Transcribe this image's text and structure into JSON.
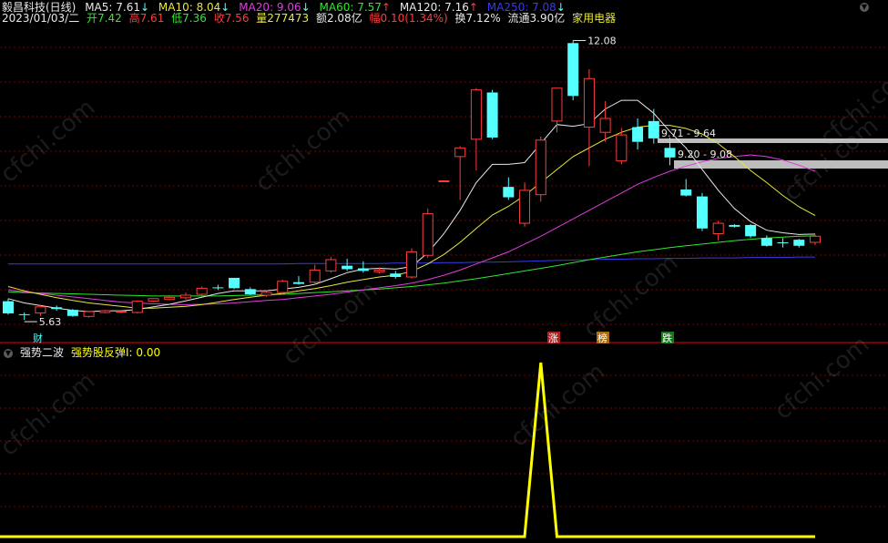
{
  "header": {
    "stock_name": "毅昌科技(日线)",
    "ma5": {
      "label": "MA5: 7.61",
      "arrow": "↓",
      "color": "#e8e8e8"
    },
    "ma10": {
      "label": "MA10: 8.04",
      "arrow": "↓",
      "color": "#e8e83a"
    },
    "ma20": {
      "label": "MA20: 9.06",
      "arrow": "↓",
      "color": "#e23ce2"
    },
    "ma60": {
      "label": "MA60: 7.57",
      "arrow": "↑",
      "color": "#2ee82e"
    },
    "ma120": {
      "label": "MA120: 7.16",
      "arrow": "↑",
      "color": "#e8e8e8"
    },
    "ma250": {
      "label": "MA250: 7.08",
      "arrow": "↓",
      "color": "#3a3ae8"
    }
  },
  "quote": {
    "date": "2023/01/03/二",
    "open": "开7.42",
    "high": "高7.61",
    "low": "低7.36",
    "close": "收7.56",
    "volume": "量277473",
    "amount": "额2.08亿",
    "change": "幅0.10(1.34%)",
    "turnover": "换7.12%",
    "float": "流通3.90亿",
    "industry": "家用电器"
  },
  "annotations": {
    "high_price": "12.08",
    "low_price": "5.63",
    "zone1": "9.71 - 9.64",
    "zone2": "9.20 - 9.08",
    "marker_cai": "财",
    "marker_zhang": "涨",
    "marker_bang": "榜",
    "marker_die": "跌"
  },
  "indicator": {
    "name": "强势二波",
    "line_label": "强势股反弹I: 0.00"
  },
  "watermark": "cfchi.com",
  "colors": {
    "up": "#ff3c3c",
    "down": "#54ffff",
    "grid": "#800000",
    "indicator": "#ffff00"
  },
  "chart_data": {
    "type": "candlestick",
    "ylim": [
      5.4,
      12.3
    ],
    "candles": [
      {
        "o": 6.06,
        "h": 6.12,
        "l": 5.75,
        "c": 5.78
      },
      {
        "o": 5.76,
        "h": 5.8,
        "l": 5.63,
        "c": 5.74
      },
      {
        "o": 5.79,
        "h": 5.98,
        "l": 5.72,
        "c": 5.93
      },
      {
        "o": 5.92,
        "h": 5.96,
        "l": 5.84,
        "c": 5.88
      },
      {
        "o": 5.86,
        "h": 5.88,
        "l": 5.7,
        "c": 5.72
      },
      {
        "o": 5.71,
        "h": 5.84,
        "l": 5.68,
        "c": 5.82
      },
      {
        "o": 5.8,
        "h": 5.86,
        "l": 5.78,
        "c": 5.84
      },
      {
        "o": 5.82,
        "h": 5.84,
        "l": 5.78,
        "c": 5.83
      },
      {
        "o": 5.8,
        "h": 6.08,
        "l": 5.78,
        "c": 6.06
      },
      {
        "o": 6.06,
        "h": 6.13,
        "l": 6.04,
        "c": 6.12
      },
      {
        "o": 6.1,
        "h": 6.18,
        "l": 6.08,
        "c": 6.15
      },
      {
        "o": 6.14,
        "h": 6.26,
        "l": 6.1,
        "c": 6.2
      },
      {
        "o": 6.22,
        "h": 6.4,
        "l": 6.16,
        "c": 6.36
      },
      {
        "o": 6.38,
        "h": 6.44,
        "l": 6.32,
        "c": 6.37
      },
      {
        "o": 6.6,
        "h": 6.6,
        "l": 6.34,
        "c": 6.36
      },
      {
        "o": 6.34,
        "h": 6.38,
        "l": 6.2,
        "c": 6.22
      },
      {
        "o": 6.2,
        "h": 6.28,
        "l": 6.16,
        "c": 6.26
      },
      {
        "o": 6.26,
        "h": 6.56,
        "l": 6.22,
        "c": 6.52
      },
      {
        "o": 6.5,
        "h": 6.64,
        "l": 6.44,
        "c": 6.46
      },
      {
        "o": 6.5,
        "h": 6.9,
        "l": 6.44,
        "c": 6.78
      },
      {
        "o": 6.76,
        "h": 7.08,
        "l": 6.72,
        "c": 7.02
      },
      {
        "o": 6.88,
        "h": 7.04,
        "l": 6.76,
        "c": 6.8
      },
      {
        "o": 6.82,
        "h": 6.98,
        "l": 6.72,
        "c": 6.76
      },
      {
        "o": 6.74,
        "h": 6.84,
        "l": 6.7,
        "c": 6.78
      },
      {
        "o": 6.7,
        "h": 6.76,
        "l": 6.58,
        "c": 6.62
      },
      {
        "o": 6.62,
        "h": 7.28,
        "l": 6.58,
        "c": 7.2
      },
      {
        "o": 7.12,
        "h": 8.2,
        "l": 7.06,
        "c": 8.08
      },
      {
        "o": 8.84,
        "h": 8.84,
        "l": 8.84,
        "c": 8.84
      },
      {
        "o": 9.4,
        "h": 9.64,
        "l": 8.4,
        "c": 9.6
      },
      {
        "o": 9.8,
        "h": 10.98,
        "l": 9.08,
        "c": 10.94
      },
      {
        "o": 10.88,
        "h": 10.94,
        "l": 9.8,
        "c": 9.84
      },
      {
        "o": 8.7,
        "h": 8.92,
        "l": 8.4,
        "c": 8.46
      },
      {
        "o": 7.86,
        "h": 8.8,
        "l": 7.78,
        "c": 8.62
      },
      {
        "o": 8.52,
        "h": 9.86,
        "l": 8.36,
        "c": 9.78
      },
      {
        "o": 10.22,
        "h": 10.72,
        "l": 9.96,
        "c": 10.98
      },
      {
        "o": 12.02,
        "h": 12.08,
        "l": 10.7,
        "c": 10.8
      },
      {
        "o": 10.08,
        "h": 11.42,
        "l": 9.18,
        "c": 11.2
      },
      {
        "o": 9.96,
        "h": 10.68,
        "l": 9.74,
        "c": 10.28
      },
      {
        "o": 9.3,
        "h": 10.06,
        "l": 9.22,
        "c": 9.9
      },
      {
        "o": 10.08,
        "h": 10.28,
        "l": 9.56,
        "c": 9.74
      },
      {
        "o": 10.22,
        "h": 10.5,
        "l": 9.7,
        "c": 9.82
      },
      {
        "o": 9.6,
        "h": 9.84,
        "l": 9.2,
        "c": 9.38
      },
      {
        "o": 8.64,
        "h": 8.88,
        "l": 8.48,
        "c": 8.5
      },
      {
        "o": 8.48,
        "h": 8.56,
        "l": 7.68,
        "c": 7.74
      },
      {
        "o": 7.62,
        "h": 7.92,
        "l": 7.46,
        "c": 7.86
      },
      {
        "o": 7.82,
        "h": 7.84,
        "l": 7.76,
        "c": 7.78
      },
      {
        "o": 7.82,
        "h": 7.84,
        "l": 7.52,
        "c": 7.56
      },
      {
        "o": 7.52,
        "h": 7.58,
        "l": 7.32,
        "c": 7.34
      },
      {
        "o": 7.42,
        "h": 7.52,
        "l": 7.3,
        "c": 7.4
      },
      {
        "o": 7.48,
        "h": 7.5,
        "l": 7.3,
        "c": 7.34
      },
      {
        "o": 7.42,
        "h": 7.61,
        "l": 7.36,
        "c": 7.56
      }
    ],
    "ma5": [
      6.12,
      6.02,
      5.96,
      5.9,
      5.85,
      5.82,
      5.84,
      5.84,
      5.87,
      5.93,
      5.99,
      6.07,
      6.15,
      6.24,
      6.3,
      6.3,
      6.3,
      6.34,
      6.38,
      6.45,
      6.58,
      6.72,
      6.8,
      6.82,
      6.8,
      6.86,
      7.18,
      7.62,
      8.16,
      8.8,
      9.22,
      9.22,
      9.26,
      9.7,
      10.14,
      10.1,
      10.16,
      10.5,
      10.7,
      10.7,
      10.4,
      9.98,
      9.6,
      9.1,
      8.62,
      8.2,
      7.9,
      7.7,
      7.64,
      7.6,
      7.61
    ],
    "ma10": [
      6.4,
      6.3,
      6.22,
      6.14,
      6.08,
      6.02,
      5.98,
      5.94,
      5.9,
      5.9,
      5.92,
      5.94,
      5.98,
      6.04,
      6.1,
      6.15,
      6.2,
      6.24,
      6.3,
      6.35,
      6.42,
      6.5,
      6.56,
      6.62,
      6.66,
      6.75,
      6.92,
      7.14,
      7.42,
      7.74,
      8.05,
      8.25,
      8.5,
      8.8,
      9.1,
      9.4,
      9.6,
      9.8,
      9.96,
      10.08,
      10.12,
      10.12,
      10.05,
      9.92,
      9.7,
      9.4,
      9.08,
      8.8,
      8.5,
      8.24,
      8.04
    ],
    "ma20": [
      6.32,
      6.28,
      6.24,
      6.2,
      6.16,
      6.12,
      6.08,
      6.04,
      6.02,
      6.0,
      5.99,
      5.98,
      5.99,
      6.0,
      6.02,
      6.05,
      6.08,
      6.1,
      6.14,
      6.18,
      6.22,
      6.27,
      6.32,
      6.37,
      6.42,
      6.48,
      6.56,
      6.66,
      6.78,
      6.92,
      7.06,
      7.2,
      7.38,
      7.56,
      7.76,
      7.96,
      8.16,
      8.36,
      8.56,
      8.76,
      8.92,
      9.06,
      9.18,
      9.28,
      9.36,
      9.4,
      9.44,
      9.4,
      9.32,
      9.2,
      9.06
    ],
    "ma60": [
      6.28,
      6.26,
      6.25,
      6.24,
      6.23,
      6.22,
      6.21,
      6.2,
      6.19,
      6.18,
      6.18,
      6.18,
      6.18,
      6.18,
      6.19,
      6.2,
      6.21,
      6.22,
      6.24,
      6.26,
      6.28,
      6.3,
      6.32,
      6.34,
      6.37,
      6.4,
      6.44,
      6.48,
      6.53,
      6.58,
      6.64,
      6.7,
      6.76,
      6.82,
      6.88,
      6.95,
      7.02,
      7.08,
      7.14,
      7.2,
      7.25,
      7.3,
      7.34,
      7.38,
      7.42,
      7.46,
      7.49,
      7.52,
      7.54,
      7.56,
      7.57
    ],
    "ma250": [
      6.92,
      6.92,
      6.92,
      6.92,
      6.92,
      6.92,
      6.92,
      6.92,
      6.92,
      6.92,
      6.92,
      6.92,
      6.92,
      6.92,
      6.92,
      6.92,
      6.92,
      6.92,
      6.93,
      6.93,
      6.93,
      6.93,
      6.93,
      6.93,
      6.94,
      6.94,
      6.94,
      6.95,
      6.95,
      6.96,
      6.96,
      6.97,
      6.98,
      6.99,
      7.0,
      7.01,
      7.02,
      7.03,
      7.03,
      7.04,
      7.04,
      7.05,
      7.05,
      7.06,
      7.06,
      7.06,
      7.07,
      7.07,
      7.07,
      7.08,
      7.08
    ],
    "indicator_values": [
      0,
      0,
      0,
      0,
      0,
      0,
      0,
      0,
      0,
      0,
      0,
      0,
      0,
      0,
      0,
      0,
      0,
      0,
      0,
      0,
      0,
      0,
      0,
      0,
      0,
      0,
      0,
      0,
      0,
      0,
      0,
      0,
      0,
      1,
      0,
      0,
      0,
      0,
      0,
      0,
      0,
      0,
      0,
      0,
      0,
      0,
      0,
      0,
      0,
      0,
      0
    ]
  }
}
